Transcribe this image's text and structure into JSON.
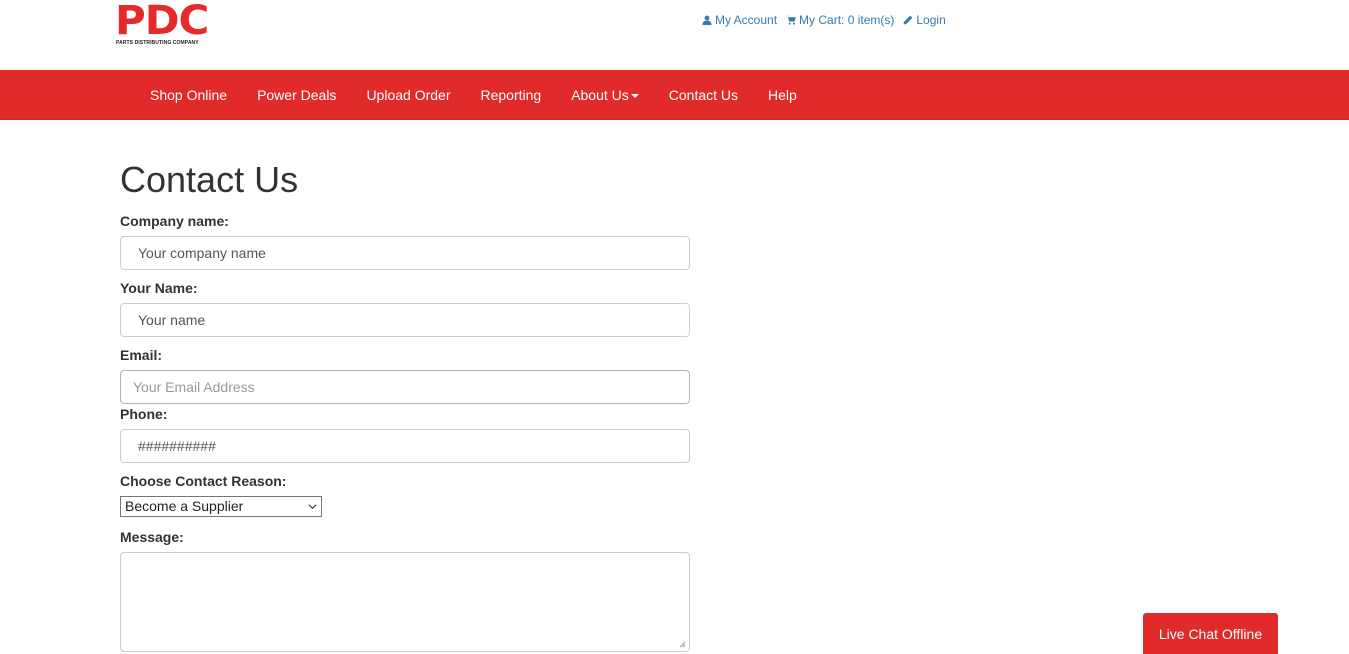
{
  "logo": {
    "letters": "PDC",
    "tagline": "PARTS DISTRIBUTING COMPANY"
  },
  "top_links": [
    {
      "icon": "user-icon",
      "label": "My Account"
    },
    {
      "icon": "cart-icon",
      "label": "My Cart: 0 item(s)"
    },
    {
      "icon": "pencil-icon",
      "label": "Login"
    }
  ],
  "nav": [
    {
      "label": "Shop Online"
    },
    {
      "label": "Power Deals"
    },
    {
      "label": "Upload Order"
    },
    {
      "label": "Reporting"
    },
    {
      "label": "About Us",
      "dropdown": true
    },
    {
      "label": "Contact Us"
    },
    {
      "label": "Help"
    }
  ],
  "page": {
    "title": "Contact Us"
  },
  "form": {
    "company_label": "Company name:",
    "company_placeholder": "Your company name",
    "name_label": "Your Name:",
    "name_placeholder": "Your name",
    "email_label": "Email:",
    "email_placeholder": "Your Email Address",
    "phone_label": "Phone:",
    "phone_placeholder": "##########",
    "reason_label": "Choose Contact Reason:",
    "reason_selected": "Become a Supplier",
    "message_label": "Message:"
  },
  "live_chat": {
    "label": "Live Chat Offline"
  },
  "colors": {
    "brand_red": "#e12a2a",
    "link_blue": "#337ab7"
  }
}
